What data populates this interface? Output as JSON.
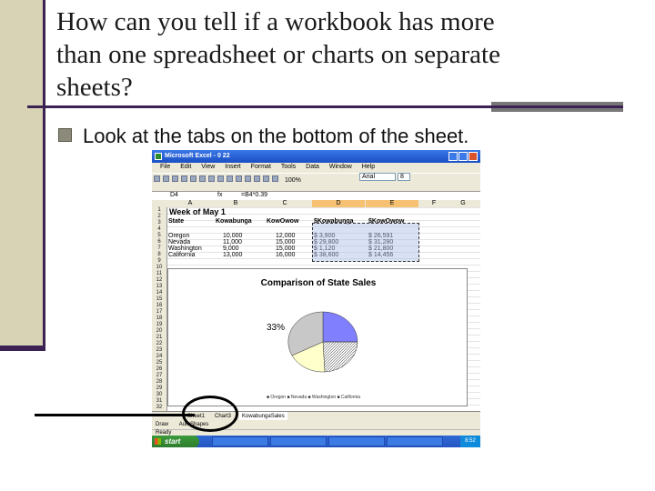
{
  "slide": {
    "title_lines": [
      "How can you tell if a workbook has more",
      "than one spreadsheet or charts on separate",
      "sheets?"
    ],
    "bullet": "Look at the tabs on the bottom of the sheet."
  },
  "screenshot": {
    "window_title": "Microsoft Excel - 0 22",
    "menu": [
      "File",
      "Edit",
      "View",
      "Insert",
      "Format",
      "Tools",
      "Data",
      "Window",
      "Help"
    ],
    "font_name": "Arial",
    "font_size": "8",
    "zoom": "100%",
    "name_box": "D4",
    "formula_value": "=B4*0.39",
    "columns": [
      "A",
      "B",
      "C",
      "D",
      "E",
      "F",
      "G"
    ],
    "sheet_title": "Week of May 1",
    "table": {
      "headers": [
        "State",
        "Kowabunga",
        "KowOwow",
        "$Kowabunga",
        "$KowOwow"
      ],
      "rows": [
        [
          "Oregon",
          "10,000",
          "12,000",
          "$  3,900",
          "$  26,591"
        ],
        [
          "Nevada",
          "11,000",
          "15,000",
          "$  29,800",
          "$  31,280"
        ],
        [
          "Washington",
          "9,000",
          "15,000",
          "$  1,120",
          "$  21,800"
        ],
        [
          "California",
          "13,000",
          "16,000",
          "$  38,600",
          "$  14,456"
        ]
      ]
    },
    "chart_title": "Comparison of State Sales",
    "chart_label": "33%",
    "chart_legend": "■ Oregon  ■ Nevada  ■ Washington  ■ California",
    "sheet_tabs": [
      "Sheet1",
      "Chart3",
      "KowabungaSales"
    ],
    "status": "Ready",
    "draw_label": "Draw",
    "autoshapes_label": "AutoShapes",
    "start_label": "start",
    "tray_time": "8:52"
  },
  "colors": {
    "accent_dark": "#3b2252",
    "accent_light": "#d7d3b4",
    "bullet_marker": "#8c8a7a",
    "pie": [
      "#8080ff",
      "#b0b0b0",
      "#ffffcc",
      "#e0e0e0"
    ]
  },
  "icons": {
    "bullet": "square-bullet-icon",
    "start_flag": "windows-flag-icon"
  }
}
